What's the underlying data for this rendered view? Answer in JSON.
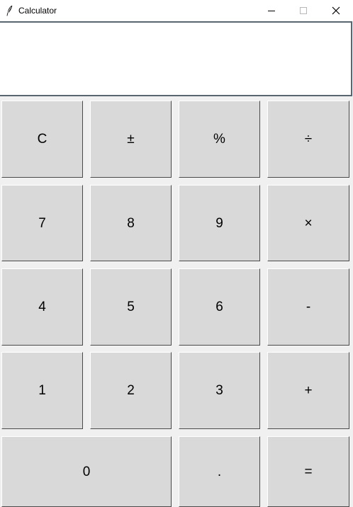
{
  "window": {
    "title": "Calculator"
  },
  "display": {
    "value": ""
  },
  "keys": {
    "clear": "C",
    "plus_minus": "±",
    "percent": "%",
    "divide": "÷",
    "seven": "7",
    "eight": "8",
    "nine": "9",
    "multiply": "×",
    "four": "4",
    "five": "5",
    "six": "6",
    "subtract": "-",
    "one": "1",
    "two": "2",
    "three": "3",
    "add": "+",
    "zero": "0",
    "decimal": ".",
    "equals": "="
  },
  "icons": {
    "app": "feather-icon",
    "minimize": "minimize-icon",
    "maximize": "maximize-icon",
    "close": "close-icon"
  },
  "colors": {
    "window_background": "#f0f0f0",
    "button_background": "#d9d9d9",
    "display_background": "#ffffff",
    "display_border": "#59656f"
  }
}
